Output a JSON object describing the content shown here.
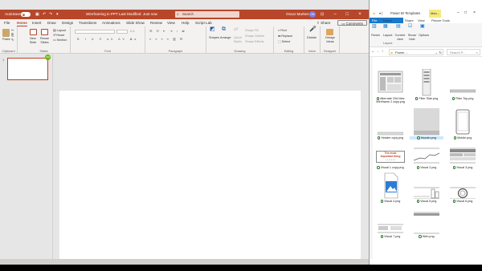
{
  "ppt": {
    "autosave_label": "AutoSave",
    "autosave_state": "On",
    "file_title": "Wireframing in PPT",
    "last_modified": "Last Modified: Just now",
    "search_placeholder": "Search",
    "user_name": "Oscar Markes",
    "user_initials": "OM",
    "tabs": [
      "File",
      "Home",
      "Insert",
      "Draw",
      "Design",
      "Transitions",
      "Animations",
      "Slide Show",
      "Review",
      "View",
      "Help",
      "Script Lab"
    ],
    "active_tab": "Home",
    "share_label": "Share",
    "comments_label": "Comments",
    "ribbon": {
      "clipboard": {
        "paste": "Paste",
        "label": "Clipboard"
      },
      "slides": {
        "new_slide": "New Slide",
        "reuse_slides": "Reuse Slides",
        "layout": "Layout",
        "reset": "Reset",
        "section": "Section",
        "label": "Slides"
      },
      "font": {
        "label": "Font"
      },
      "paragraph": {
        "label": "Paragraph"
      },
      "drawing": {
        "shapes": "Shapes",
        "arrange": "Arrange",
        "quick_styles": "Quick Styles",
        "shape_fill": "Shape Fill",
        "shape_outline": "Shape Outline",
        "shape_effects": "Shape Effects",
        "label": "Drawing"
      },
      "editing": {
        "find": "Find",
        "replace": "Replace",
        "select": "Select",
        "label": "Editing"
      },
      "voice": {
        "dictate": "Dictate",
        "label": "Voice"
      },
      "designer": {
        "design_ideas": "Design Ideas",
        "label": "Designer"
      }
    },
    "slide_number": "1"
  },
  "explorer": {
    "title": "Power BI Templates",
    "tabs": [
      "File",
      "Home",
      "Share",
      "View",
      "Picture Tools"
    ],
    "manage_label": "Man...",
    "ribbon": {
      "panes": "Panes",
      "layout": "Layout",
      "current_view": "Current view",
      "show_hide": "Show/ hide",
      "options": "Options",
      "layout_group": "Layout"
    },
    "address": "Power ...",
    "search_placeholder": "Search P...",
    "files": [
      {
        "name": "Alternate 23d New Wireframe 2 copy.png"
      },
      {
        "name": "Filter Side.png"
      },
      {
        "name": "Filter Top.png"
      },
      {
        "name": "Header copy.png"
      },
      {
        "name": "Header.png"
      },
      {
        "name": "Mobile.png"
      },
      {
        "name": "Visual 1 copy.png"
      },
      {
        "name": "Visual 2.png"
      },
      {
        "name": "Visual 3.png"
      },
      {
        "name": "Visual 4.png"
      },
      {
        "name": "Visual 5.png"
      },
      {
        "name": "Visual 6.png"
      },
      {
        "name": "Visual 7.png"
      },
      {
        "name": "Web.png"
      }
    ],
    "visual1_text": [
      "The most",
      "important thing",
      "• • • • • • •"
    ]
  },
  "colors": {
    "accent": "#b7472a",
    "explorer_blue": "#1979ca"
  }
}
